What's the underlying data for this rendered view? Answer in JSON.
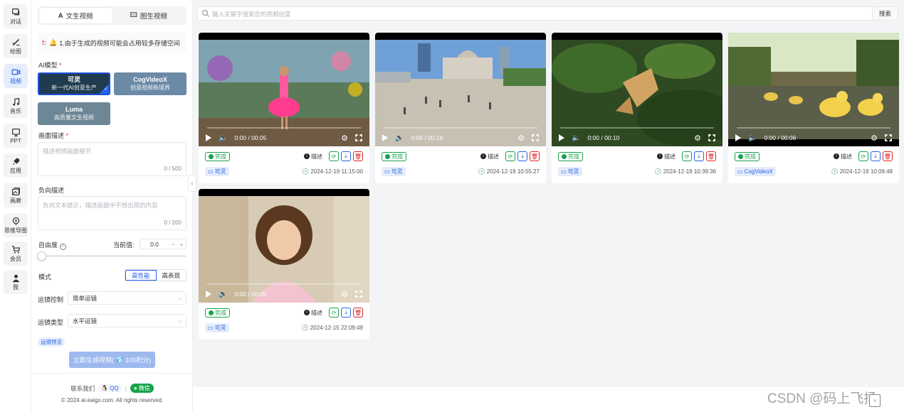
{
  "nav": [
    {
      "label": "对话",
      "icon": "chat-icon"
    },
    {
      "label": "绘图",
      "icon": "paint-brush-icon"
    },
    {
      "label": "视频",
      "icon": "video-camera-icon",
      "active": true
    },
    {
      "label": "音乐",
      "icon": "music-note-icon"
    },
    {
      "label": "PPT",
      "icon": "presentation-icon"
    },
    {
      "label": "应用",
      "icon": "rocket-icon"
    },
    {
      "label": "画廊",
      "icon": "gallery-icon"
    },
    {
      "label": "思维导图",
      "icon": "mind-map-icon"
    },
    {
      "label": "会员",
      "icon": "cart-icon"
    },
    {
      "label": "我",
      "icon": "user-icon"
    }
  ],
  "panel": {
    "tabs": [
      {
        "label": "文生视频",
        "icon": "text-icon",
        "active": true
      },
      {
        "label": "图生视频",
        "icon": "image-icon",
        "active": false
      }
    ],
    "notice": "1.由于生成的视频可能会占用较多存储空间",
    "model_label": "AI模型",
    "models": [
      {
        "name": "可灵",
        "sub": "新一代AI创意生产",
        "selected": true,
        "color": "#1f3b4d"
      },
      {
        "name": "CogVideoX",
        "sub": "创意视频新境界",
        "selected": false,
        "color": "#6b8aa6"
      },
      {
        "name": "Luma",
        "sub": "高质量文生视频",
        "selected": false,
        "color": "#6d8796"
      }
    ],
    "prompt_label": "画面描述",
    "prompt_placeholder": "描述视频画面细节",
    "prompt_count": "0 / 500",
    "negative_label": "负向描述",
    "negative_placeholder": "负向文本提示，描述画面中不想出现的内容",
    "negative_count": "0 / 200",
    "freedom_label": "自由度",
    "current_value_label": "当前值:",
    "current_value": "0.0",
    "freedom_level": 0.0,
    "mode_label": "模式",
    "modes": [
      {
        "label": "高性能",
        "active": true
      },
      {
        "label": "高表现",
        "active": false
      }
    ],
    "camera_control_label": "运镜控制",
    "camera_control_value": "简单运镜",
    "camera_type_label": "运镜类型",
    "camera_type_value": "水平运镜",
    "preset_chip": "运镜预览",
    "generate_button": "立即生成视频( 💎 100积分)",
    "contact_label": "联系我们",
    "qq_label": "QQ",
    "wechat_label": "微信",
    "copyright": "© 2024 ai.eaigx.com. All rights reserved."
  },
  "search": {
    "placeholder": "输入关键字搜索您的视频创意",
    "button": "搜索"
  },
  "videos": [
    {
      "time": "0:00 / 00:05",
      "status": "完成",
      "desc": "描述",
      "model": "可灵",
      "timestamp": "2024-12-19 11:15:00",
      "scene": "girl-dancing"
    },
    {
      "time": "0:00 / 00:10",
      "status": "完成",
      "desc": "描述",
      "model": "可灵",
      "timestamp": "2024-12-19 10:55:27",
      "scene": "city-square"
    },
    {
      "time": "0:00 / 00:10",
      "status": "完成",
      "desc": "描述",
      "model": "可灵",
      "timestamp": "2024-12-19 10:39:36",
      "scene": "forest-animal"
    },
    {
      "time": "0:00 / 00:06",
      "status": "完成",
      "desc": "描述",
      "model": "CogVideoX",
      "timestamp": "2024-12-19 10:09:48",
      "scene": "ducklings"
    },
    {
      "time": "0:00 / 00:05",
      "status": "完成",
      "desc": "描述",
      "model": "可灵",
      "timestamp": "2024-12-15 22:09:49",
      "scene": "smiling-girl"
    }
  ],
  "watermark": "CSDN @码上飞扬",
  "colors": {
    "accent": "#2563eb",
    "success": "#16a34a",
    "danger": "#dc2626",
    "main_bg": "#f3f4f6"
  }
}
